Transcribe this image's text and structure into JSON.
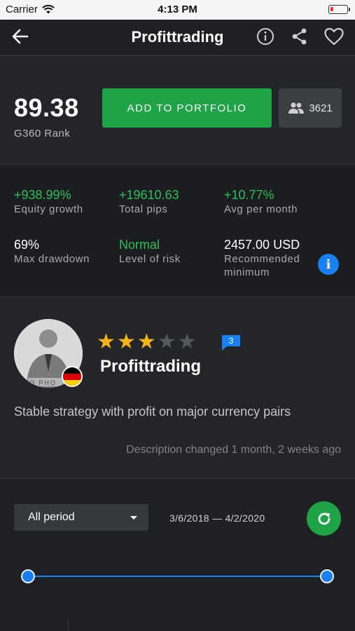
{
  "status_bar": {
    "carrier": "Carrier",
    "time": "4:13 PM"
  },
  "nav": {
    "title": "Profittrading"
  },
  "rank": {
    "value": "89.38",
    "label": "G360 Rank"
  },
  "actions": {
    "add_to_portfolio": "ADD TO PORTFOLIO",
    "followers_count": "3621"
  },
  "stats": [
    {
      "value": "+938.99%",
      "label": "Equity growth"
    },
    {
      "value": "+19610.63",
      "label": "Total pips"
    },
    {
      "value": "+10.77%",
      "label": "Avg per month"
    },
    {
      "value": "69%",
      "label": "Max drawdown"
    },
    {
      "value": "Normal",
      "label": "Level of risk"
    },
    {
      "value": "2457.00 USD",
      "label_line1": "Recommended",
      "label_line2": "minimum"
    }
  ],
  "profile": {
    "name": "Profittrading",
    "rating": 3,
    "rating_max": 5,
    "comments_count": "3",
    "avatar_watermark": "O PHO",
    "description": "Stable strategy with profit on major currency pairs",
    "description_changed": "Description changed 1 month, 2 weeks ago"
  },
  "period": {
    "selected": "All period",
    "date_range": "3/6/2018 — 4/2/2020"
  },
  "colors": {
    "accent_green": "#1ea446",
    "positive_text": "#2bbf5a",
    "accent_blue": "#1a7ff0",
    "star": "#f3b41b"
  }
}
